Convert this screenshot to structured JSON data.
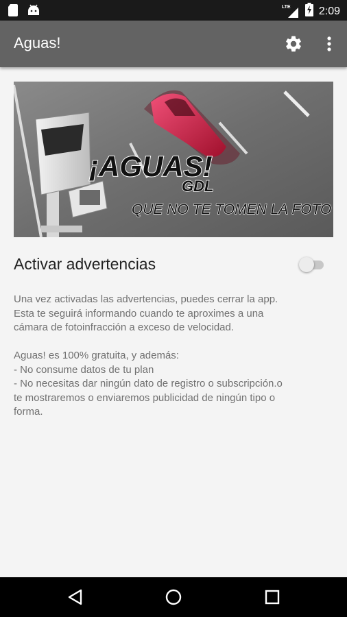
{
  "status_bar": {
    "time": "2:09",
    "network": "LTE",
    "battery_level": "charging",
    "icons": [
      "sd-card-icon",
      "android-icon",
      "lte-signal-icon",
      "battery-icon"
    ]
  },
  "app_bar": {
    "title": "Aguas!",
    "actions": [
      "settings-icon",
      "overflow-menu-icon"
    ]
  },
  "banner": {
    "headline": "¡AGUAS!",
    "subhead": "GDL",
    "tagline": "QUE NO TE TOMEN LA FOTO"
  },
  "settings": {
    "toggle_label": "Activar advertencias",
    "toggle_on": false
  },
  "description": {
    "para1": [
      "Una vez activadas las advertencias, puedes cerrar la app.",
      "Esta te seguirá informando cuando te aproximes a una",
      "cámara de fotoinfracción a exceso de velocidad."
    ],
    "para2": [
      "Aguas! es 100% gratuita, y además:",
      "- No consume datos de tu plan",
      "- No necesitas dar ningún dato de registro o subscripción.o",
      "te mostraremos o enviaremos publicidad de ningún tipo o",
      "forma."
    ]
  },
  "navbar": {
    "buttons": [
      "back-icon",
      "home-icon",
      "recents-icon"
    ]
  },
  "colors": {
    "status_bar": "#1a1a1a",
    "app_bar": "#636363",
    "background": "#f4f4f4",
    "text_primary": "#222222",
    "text_secondary": "#707070",
    "car_accent": "#d0204a"
  }
}
